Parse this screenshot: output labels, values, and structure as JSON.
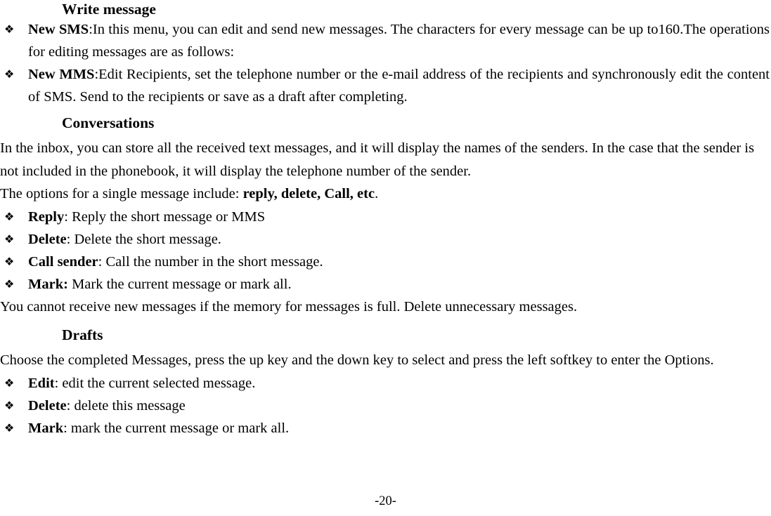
{
  "document": {
    "page_number_label": "-20-",
    "bullet_glyph": "❖"
  },
  "sections": [
    {
      "heading": "Write message",
      "items": [
        {
          "bold": "New SMS",
          "rest": ":In this menu, you can edit and send new messages. The characters for every message can be up to160.The operations for editing messages are as follows:"
        },
        {
          "bold": "New MMS",
          "rest": ":Edit Recipients, set the telephone number or the e-mail address of the recipients and synchronously edit the content of SMS. Send to the recipients or save as a draft after completing."
        }
      ]
    },
    {
      "heading": "Conversations",
      "intro_para_1": "In the inbox, you can store all the received text messages, and it will display the names of the senders. In the case that the sender is not included in the phonebook, it will display the telephone number of the sender.",
      "intro_para_2_prefix": "The options for a single message include: ",
      "intro_para_2_bold": "reply, delete, Call, etc",
      "intro_para_2_suffix": ".",
      "items": [
        {
          "bold": "Reply",
          "rest": ": Reply the short message or MMS"
        },
        {
          "bold": "Delete",
          "rest": ": Delete the short message."
        },
        {
          "bold": "Call sender",
          "rest": ": Call the number in the short message."
        },
        {
          "bold": "Mark:",
          "rest": " Mark the current message or mark all."
        }
      ],
      "closing_para": "You cannot receive new messages if the memory for messages is full. Delete unnecessary messages."
    },
    {
      "heading": "Drafts",
      "intro_para": "Choose the completed Messages, press the up key and the down key to select and press the left softkey to enter the Options.",
      "items": [
        {
          "bold": "Edit",
          "rest": ": edit the current selected message."
        },
        {
          "bold": "Delete",
          "rest": ": delete this message"
        },
        {
          "bold": "Mark",
          "rest": ": mark the current message or mark all."
        }
      ]
    }
  ]
}
